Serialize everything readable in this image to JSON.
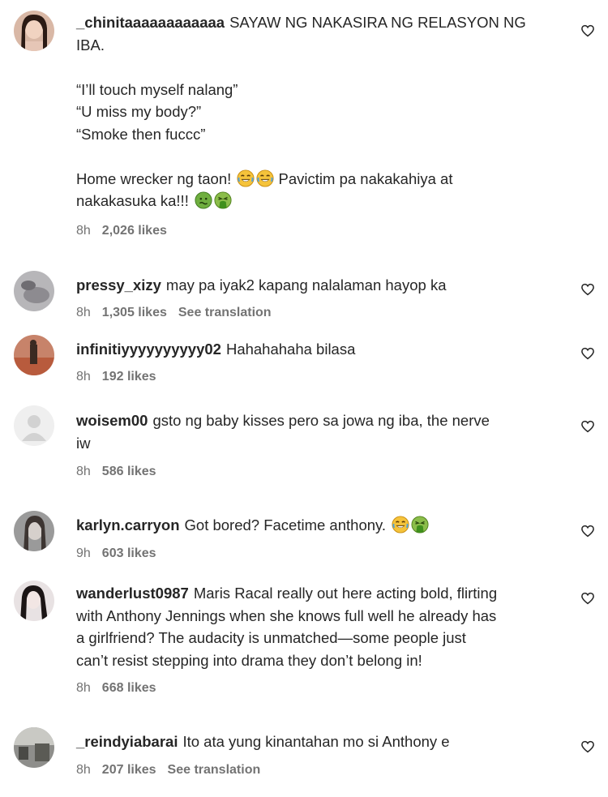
{
  "comments": [
    {
      "username": "_chinitaaaaaaaaaaaa",
      "text_first": "SAYAW NG NAKASIRA NG RELASYON NG",
      "text_rest": "IBA.\n\n“I’ll touch myself nalang”\n“U miss my body?”\n“Smoke then fuccc”\n\nHome wrecker ng taon!",
      "text_mid": " Pavictim pa nakakahiya at",
      "text_end": "nakakasuka ka!!!",
      "time": "8h",
      "likes": "2,026 likes",
      "translation": ""
    },
    {
      "username": "pressy_xizy",
      "text": "may pa iyak2 kapang nalalaman hayop ka",
      "time": "8h",
      "likes": "1,305 likes",
      "translation": "See translation"
    },
    {
      "username": "infinitiyyyyyyyyyy02",
      "text": "Hahahahaha bilasa",
      "time": "8h",
      "likes": "192 likes",
      "translation": ""
    },
    {
      "username": "woisem00",
      "text_first": "gsto ng baby kisses pero sa jowa ng iba, the nerve",
      "text_rest": "iw",
      "time": "8h",
      "likes": "586 likes",
      "translation": ""
    },
    {
      "username": "karlyn.carryon",
      "text": "Got bored? Facetime anthony.",
      "time": "9h",
      "likes": "603 likes",
      "translation": ""
    },
    {
      "username": "wanderlust0987",
      "text_first": "Maris Racal really out here acting bold, flirting",
      "text_rest": "with Anthony Jennings when she knows full well he already has\na girlfriend? The audacity is unmatched—some people just\ncan’t resist stepping into drama they don’t belong in!",
      "time": "8h",
      "likes": "668 likes",
      "translation": ""
    },
    {
      "username": "_reindyiabarai",
      "text": "Ito ata yung kinantahan mo si Anthony e",
      "time": "8h",
      "likes": "207 likes",
      "translation": "See translation"
    }
  ],
  "icons": {
    "like": "heart-outline-icon",
    "laugh": "face-with-tears-of-joy-icon",
    "sick": "nauseated-face-icon",
    "vomit": "face-vomiting-icon"
  },
  "colors": {
    "text": "#262626",
    "meta": "#737373",
    "background": "#ffffff"
  }
}
